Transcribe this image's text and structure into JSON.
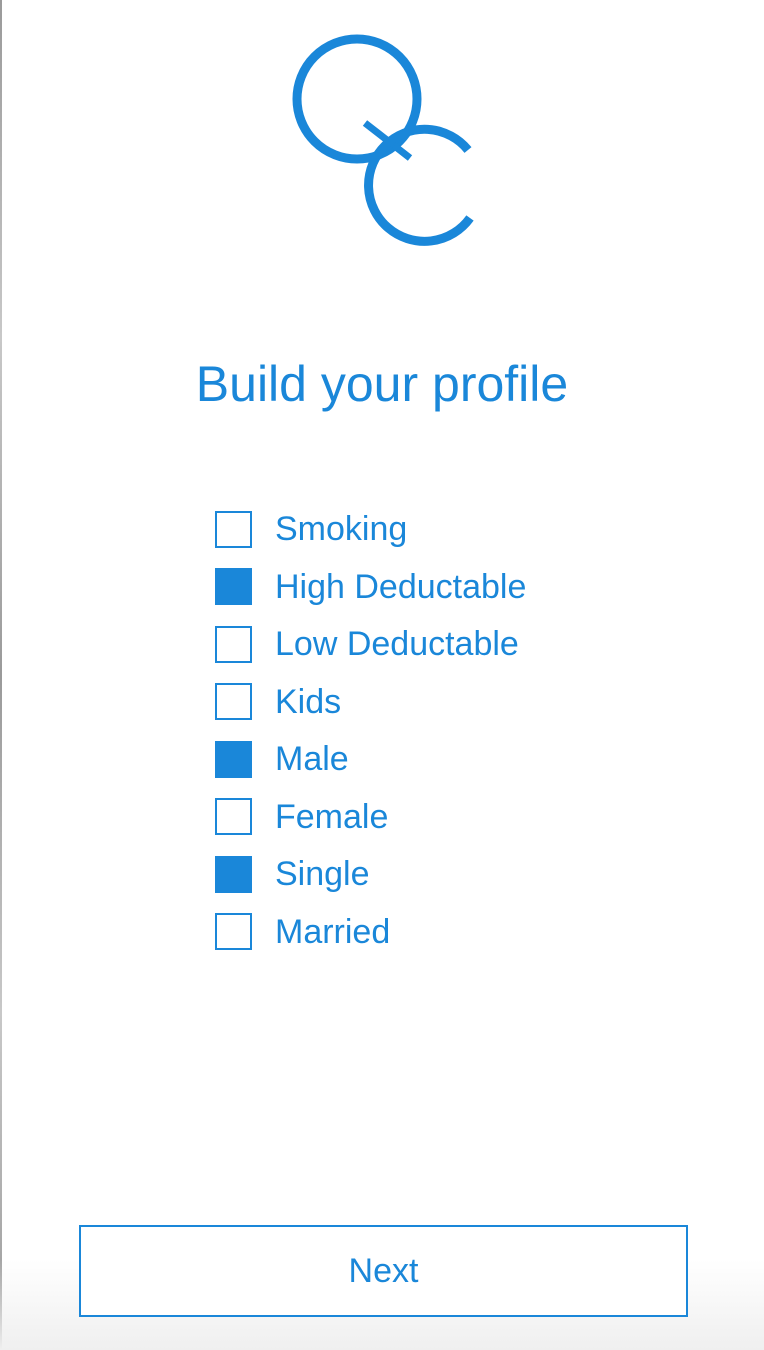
{
  "app": {
    "logo_icon": "qc-logo-icon",
    "accent_color": "#1a87d9"
  },
  "header": {
    "title": "Build your profile"
  },
  "profile_options": [
    {
      "label": "Smoking",
      "checked": false
    },
    {
      "label": "High Deductable",
      "checked": true
    },
    {
      "label": "Low Deductable",
      "checked": false
    },
    {
      "label": "Kids",
      "checked": false
    },
    {
      "label": "Male",
      "checked": true
    },
    {
      "label": "Female",
      "checked": false
    },
    {
      "label": "Single",
      "checked": true
    },
    {
      "label": "Married",
      "checked": false
    }
  ],
  "footer": {
    "next_label": "Next"
  }
}
